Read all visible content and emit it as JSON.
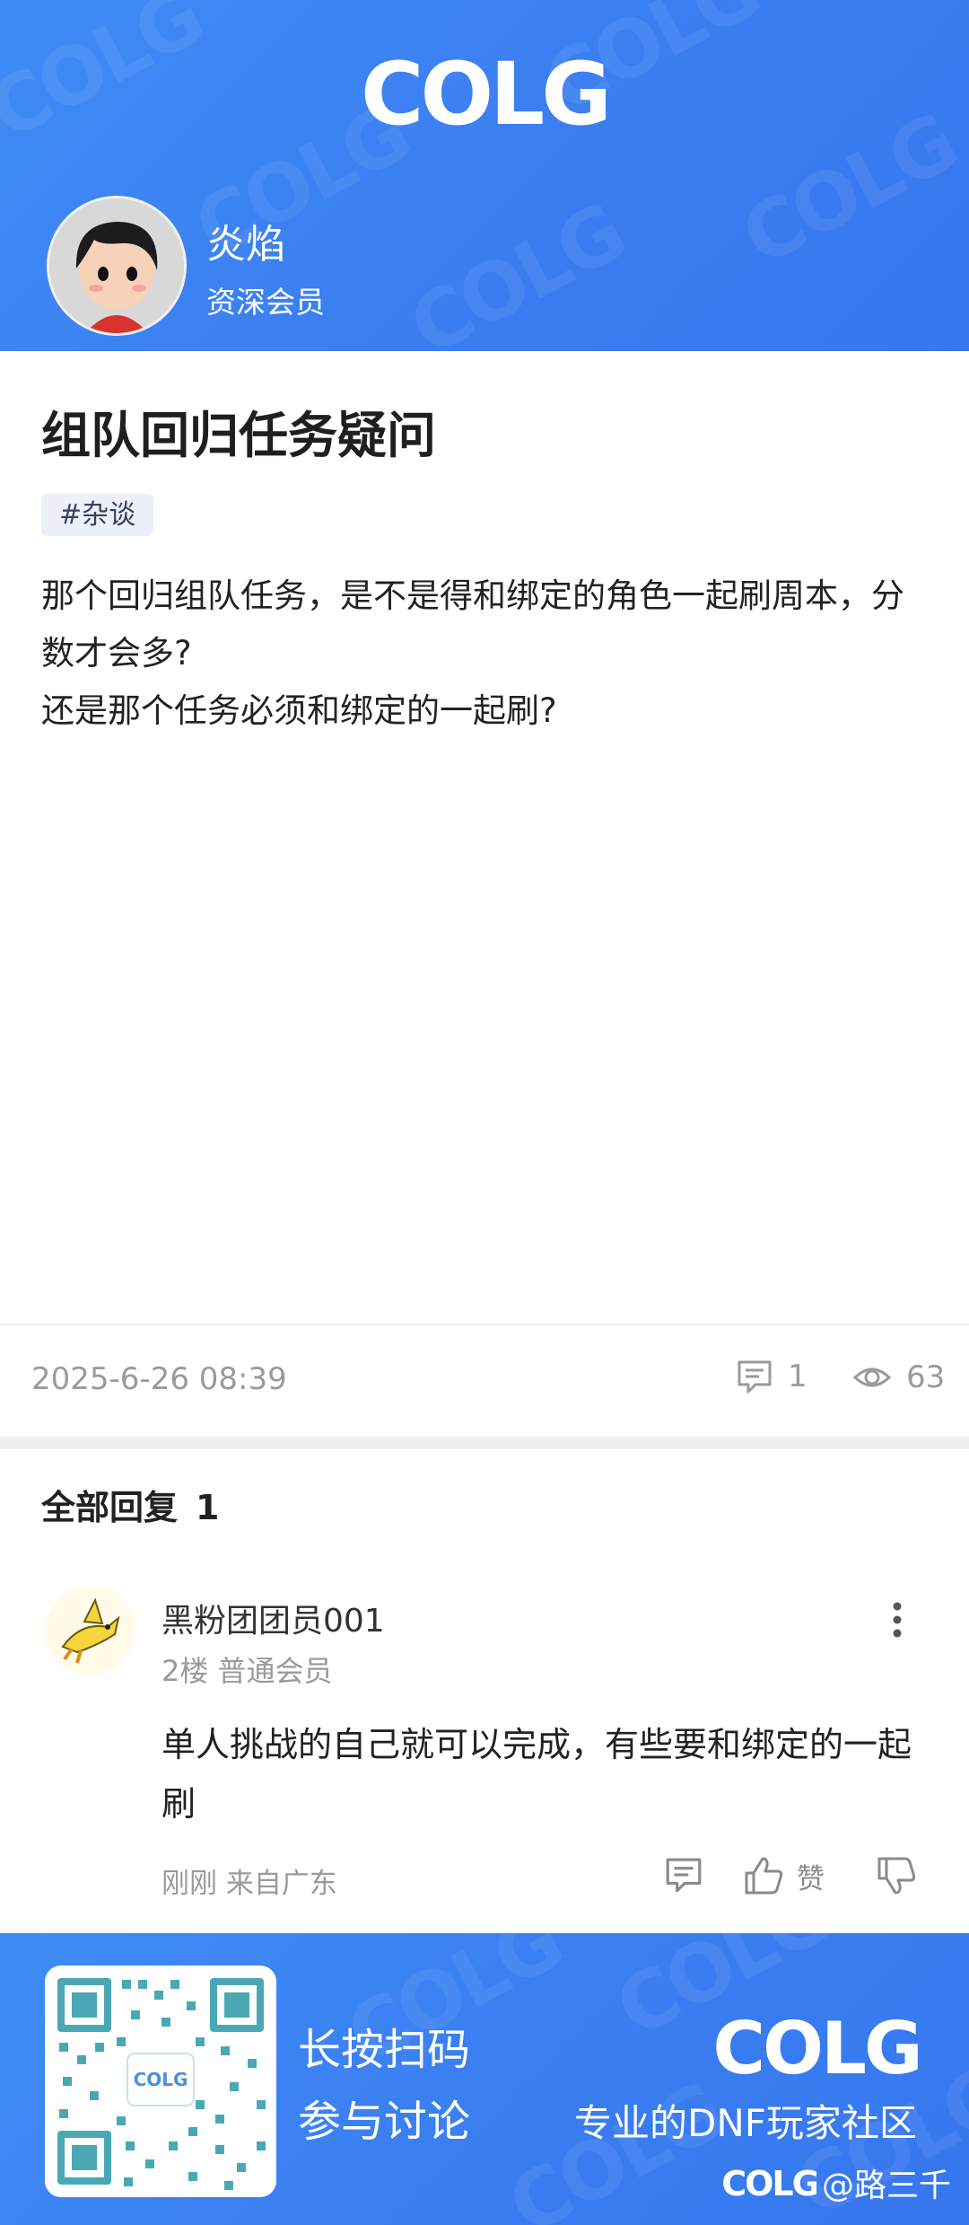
{
  "header": {
    "logo_text": "COLG",
    "author": {
      "name": "炎焰",
      "level": "资深会员"
    }
  },
  "post": {
    "title": "组队回归任务疑问",
    "tag": "#杂谈",
    "body_lines": [
      "那个回归组队任务，是不是得和绑定的角色一起刷周本，分数才会多?",
      "还是那个任务必须和绑定的一起刷?"
    ],
    "time": "2025-6-26 08:39",
    "comment_count": "1",
    "view_count": "63"
  },
  "replies": {
    "title": "全部回复",
    "count": "1",
    "items": [
      {
        "name": "黑粉团团员001",
        "floor_level": "2楼 普通会员",
        "body": "单人挑战的自己就可以完成，有些要和绑定的一起刷",
        "time_location": "刚刚 来自广东",
        "like_label": "赞"
      }
    ]
  },
  "footer": {
    "qr_logo_text": "COLG",
    "scan_line1": "长按扫码",
    "scan_line2": "参与讨论",
    "logo_text": "COLG",
    "slogan": "专业的DNF玩家社区",
    "credit_logo_text": "COLG",
    "credit_user": "@路三千"
  },
  "colors": {
    "brand_blue": "#3a7df0",
    "tag_bg": "#edf0f8",
    "muted": "#9a9a9a"
  }
}
